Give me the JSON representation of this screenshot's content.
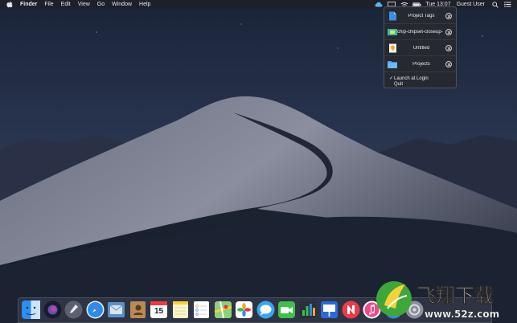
{
  "menubar": {
    "app_name": "Finder",
    "menus": [
      "File",
      "Edit",
      "View",
      "Go",
      "Window",
      "Help"
    ],
    "clock": "Tue 13:07",
    "user": "Guest User"
  },
  "panel": {
    "items": [
      {
        "label": "Project Tags",
        "icon": "document-icon"
      },
      {
        "label": "chip-chipset-closeup-",
        "icon": "image-icon"
      },
      {
        "label": "Untitled",
        "icon": "sketch-document-icon"
      },
      {
        "label": "Projects",
        "icon": "folder-icon"
      }
    ],
    "launch_at_login": {
      "label": "Launch at Login",
      "checked": true,
      "check_mark": "✓"
    },
    "quit_label": "Quit"
  },
  "dock": {
    "apps": [
      "finder",
      "siri",
      "launchpad",
      "safari",
      "mail",
      "contacts",
      "calendar",
      "notes",
      "reminders",
      "maps",
      "photos",
      "messages",
      "facetime",
      "numbers",
      "keynote",
      "news",
      "itunes",
      "app-store",
      "system-preferences"
    ],
    "calendar_day": "15"
  },
  "watermark": {
    "brand": "飞翔下载",
    "url": "www.52z.com"
  }
}
